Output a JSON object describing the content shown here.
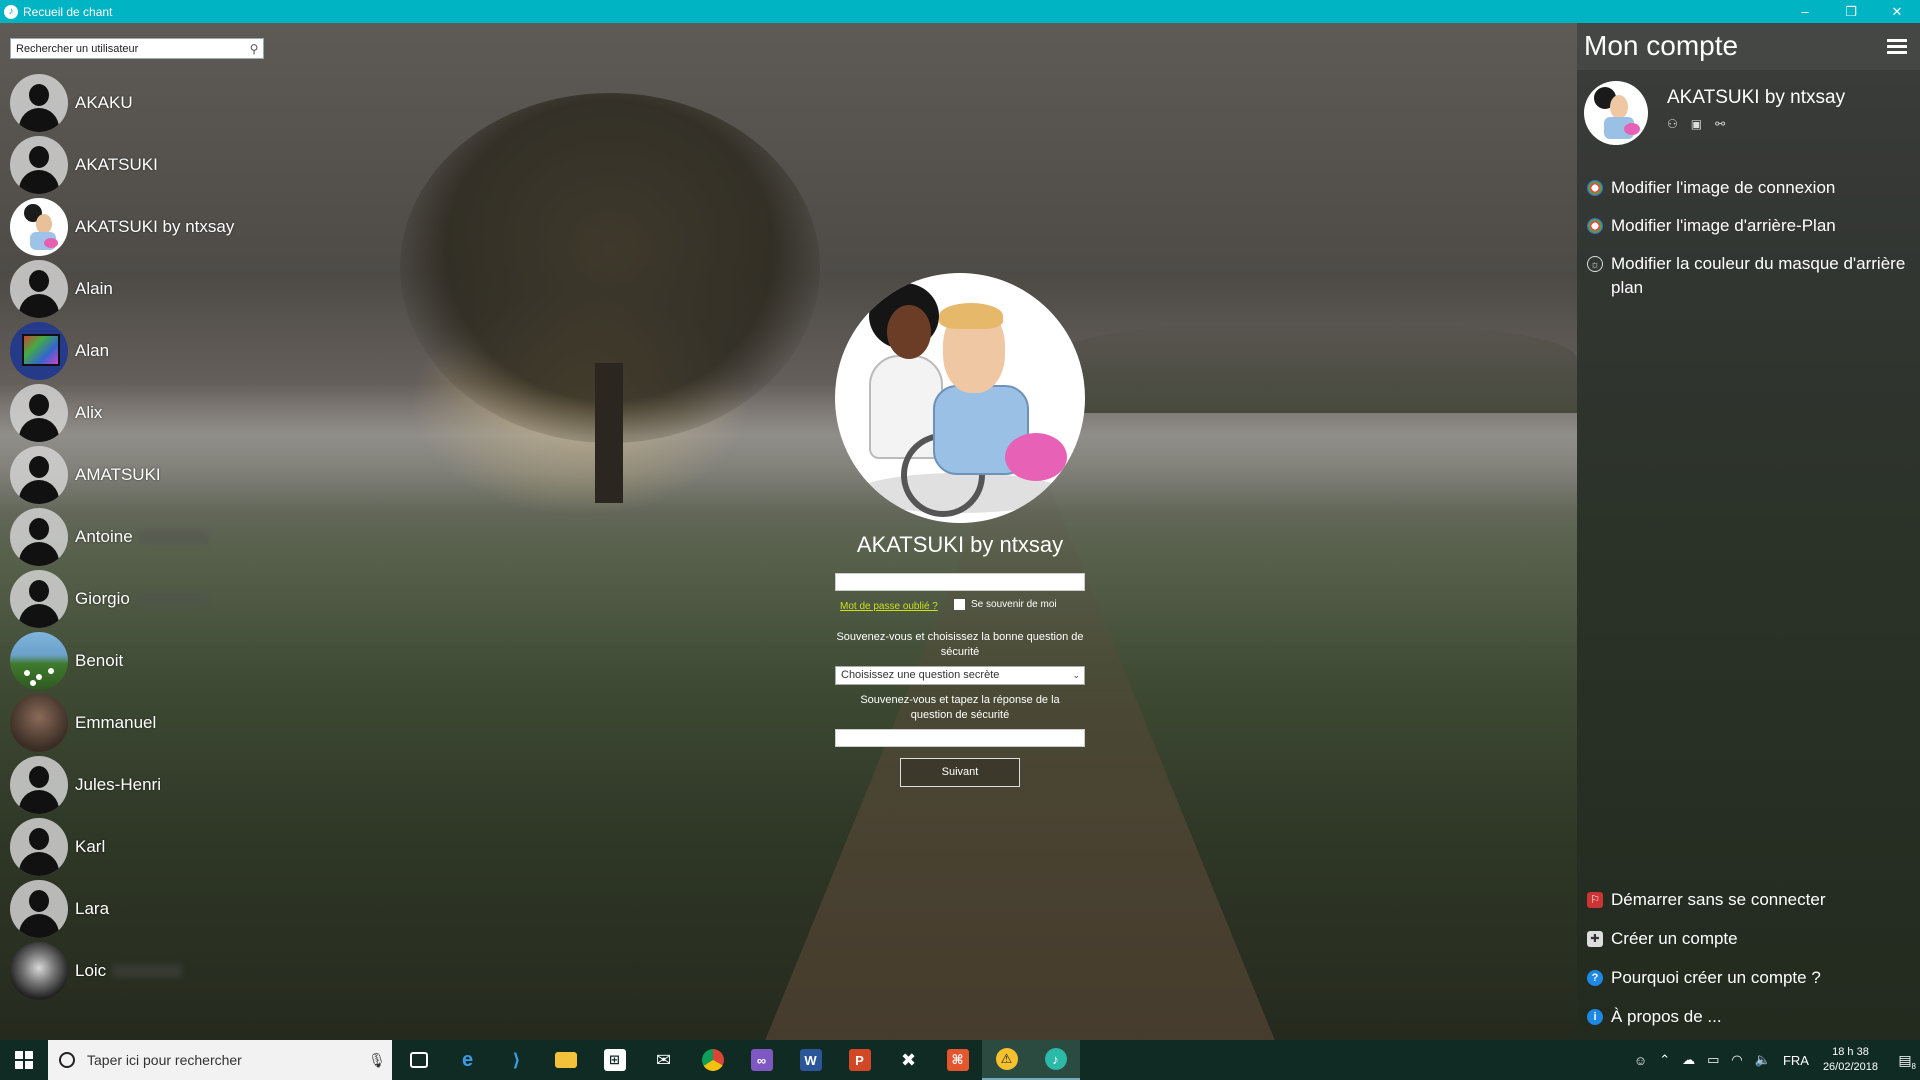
{
  "window": {
    "title": "Recueil de chant",
    "minimize": "–",
    "restore": "❐",
    "close": "✕"
  },
  "search": {
    "placeholder": "Rechercher un utilisateur",
    "icon": "user-search-icon"
  },
  "users": [
    {
      "name": "AKAKU",
      "avatar": "default"
    },
    {
      "name": "AKATSUKI",
      "avatar": "default"
    },
    {
      "name": "AKATSUKI by ntxsay",
      "avatar": "cartoon"
    },
    {
      "name": "Alain",
      "avatar": "default"
    },
    {
      "name": "Alan",
      "avatar": "tablet"
    },
    {
      "name": "Alix",
      "avatar": "default"
    },
    {
      "name": "AMATSUKI",
      "avatar": "default"
    },
    {
      "name": "Antoine",
      "avatar": "default"
    },
    {
      "name": "Giorgio",
      "avatar": "default"
    },
    {
      "name": "Benoit",
      "avatar": "flower"
    },
    {
      "name": "Emmanuel",
      "avatar": "man"
    },
    {
      "name": "Jules-Henri",
      "avatar": "default"
    },
    {
      "name": "Karl",
      "avatar": "default"
    },
    {
      "name": "Lara",
      "avatar": "default"
    },
    {
      "name": "Loic",
      "avatar": "dark"
    }
  ],
  "login": {
    "username": "AKATSUKI by ntxsay",
    "forgot_password": "Mot de passe oublié ?",
    "remember_me": "Se souvenir de moi",
    "security_question_label": "Souvenez-vous et choisissez la bonne question de sécurité",
    "security_question_select": "Choisissez une question secrète",
    "security_answer_label": "Souvenez-vous et tapez la réponse de la question de sécurité",
    "next_button": "Suivant"
  },
  "account_panel": {
    "title": "Mon compte",
    "username": "AKATSUKI by ntxsay",
    "menu": [
      {
        "label": "Modifier l'image de connexion",
        "icon": "flower-icon"
      },
      {
        "label": "Modifier l'image d'arrière-Plan",
        "icon": "flower-icon"
      },
      {
        "label": "Modifier la couleur du masque d'arrière plan",
        "icon": "palette-icon"
      }
    ],
    "bottom_menu": [
      {
        "label": "Démarrer sans se connecter",
        "icon": "no-login-icon"
      },
      {
        "label": "Créer un compte",
        "icon": "create-account-icon"
      },
      {
        "label": "Pourquoi créer un compte ?",
        "icon": "help-icon"
      },
      {
        "label": "À propos de ...",
        "icon": "info-icon"
      }
    ]
  },
  "taskbar": {
    "search_placeholder": "Taper ici pour rechercher",
    "language": "FRA",
    "time": "18 h 38",
    "date": "26/02/2018",
    "notification_count": "8"
  }
}
